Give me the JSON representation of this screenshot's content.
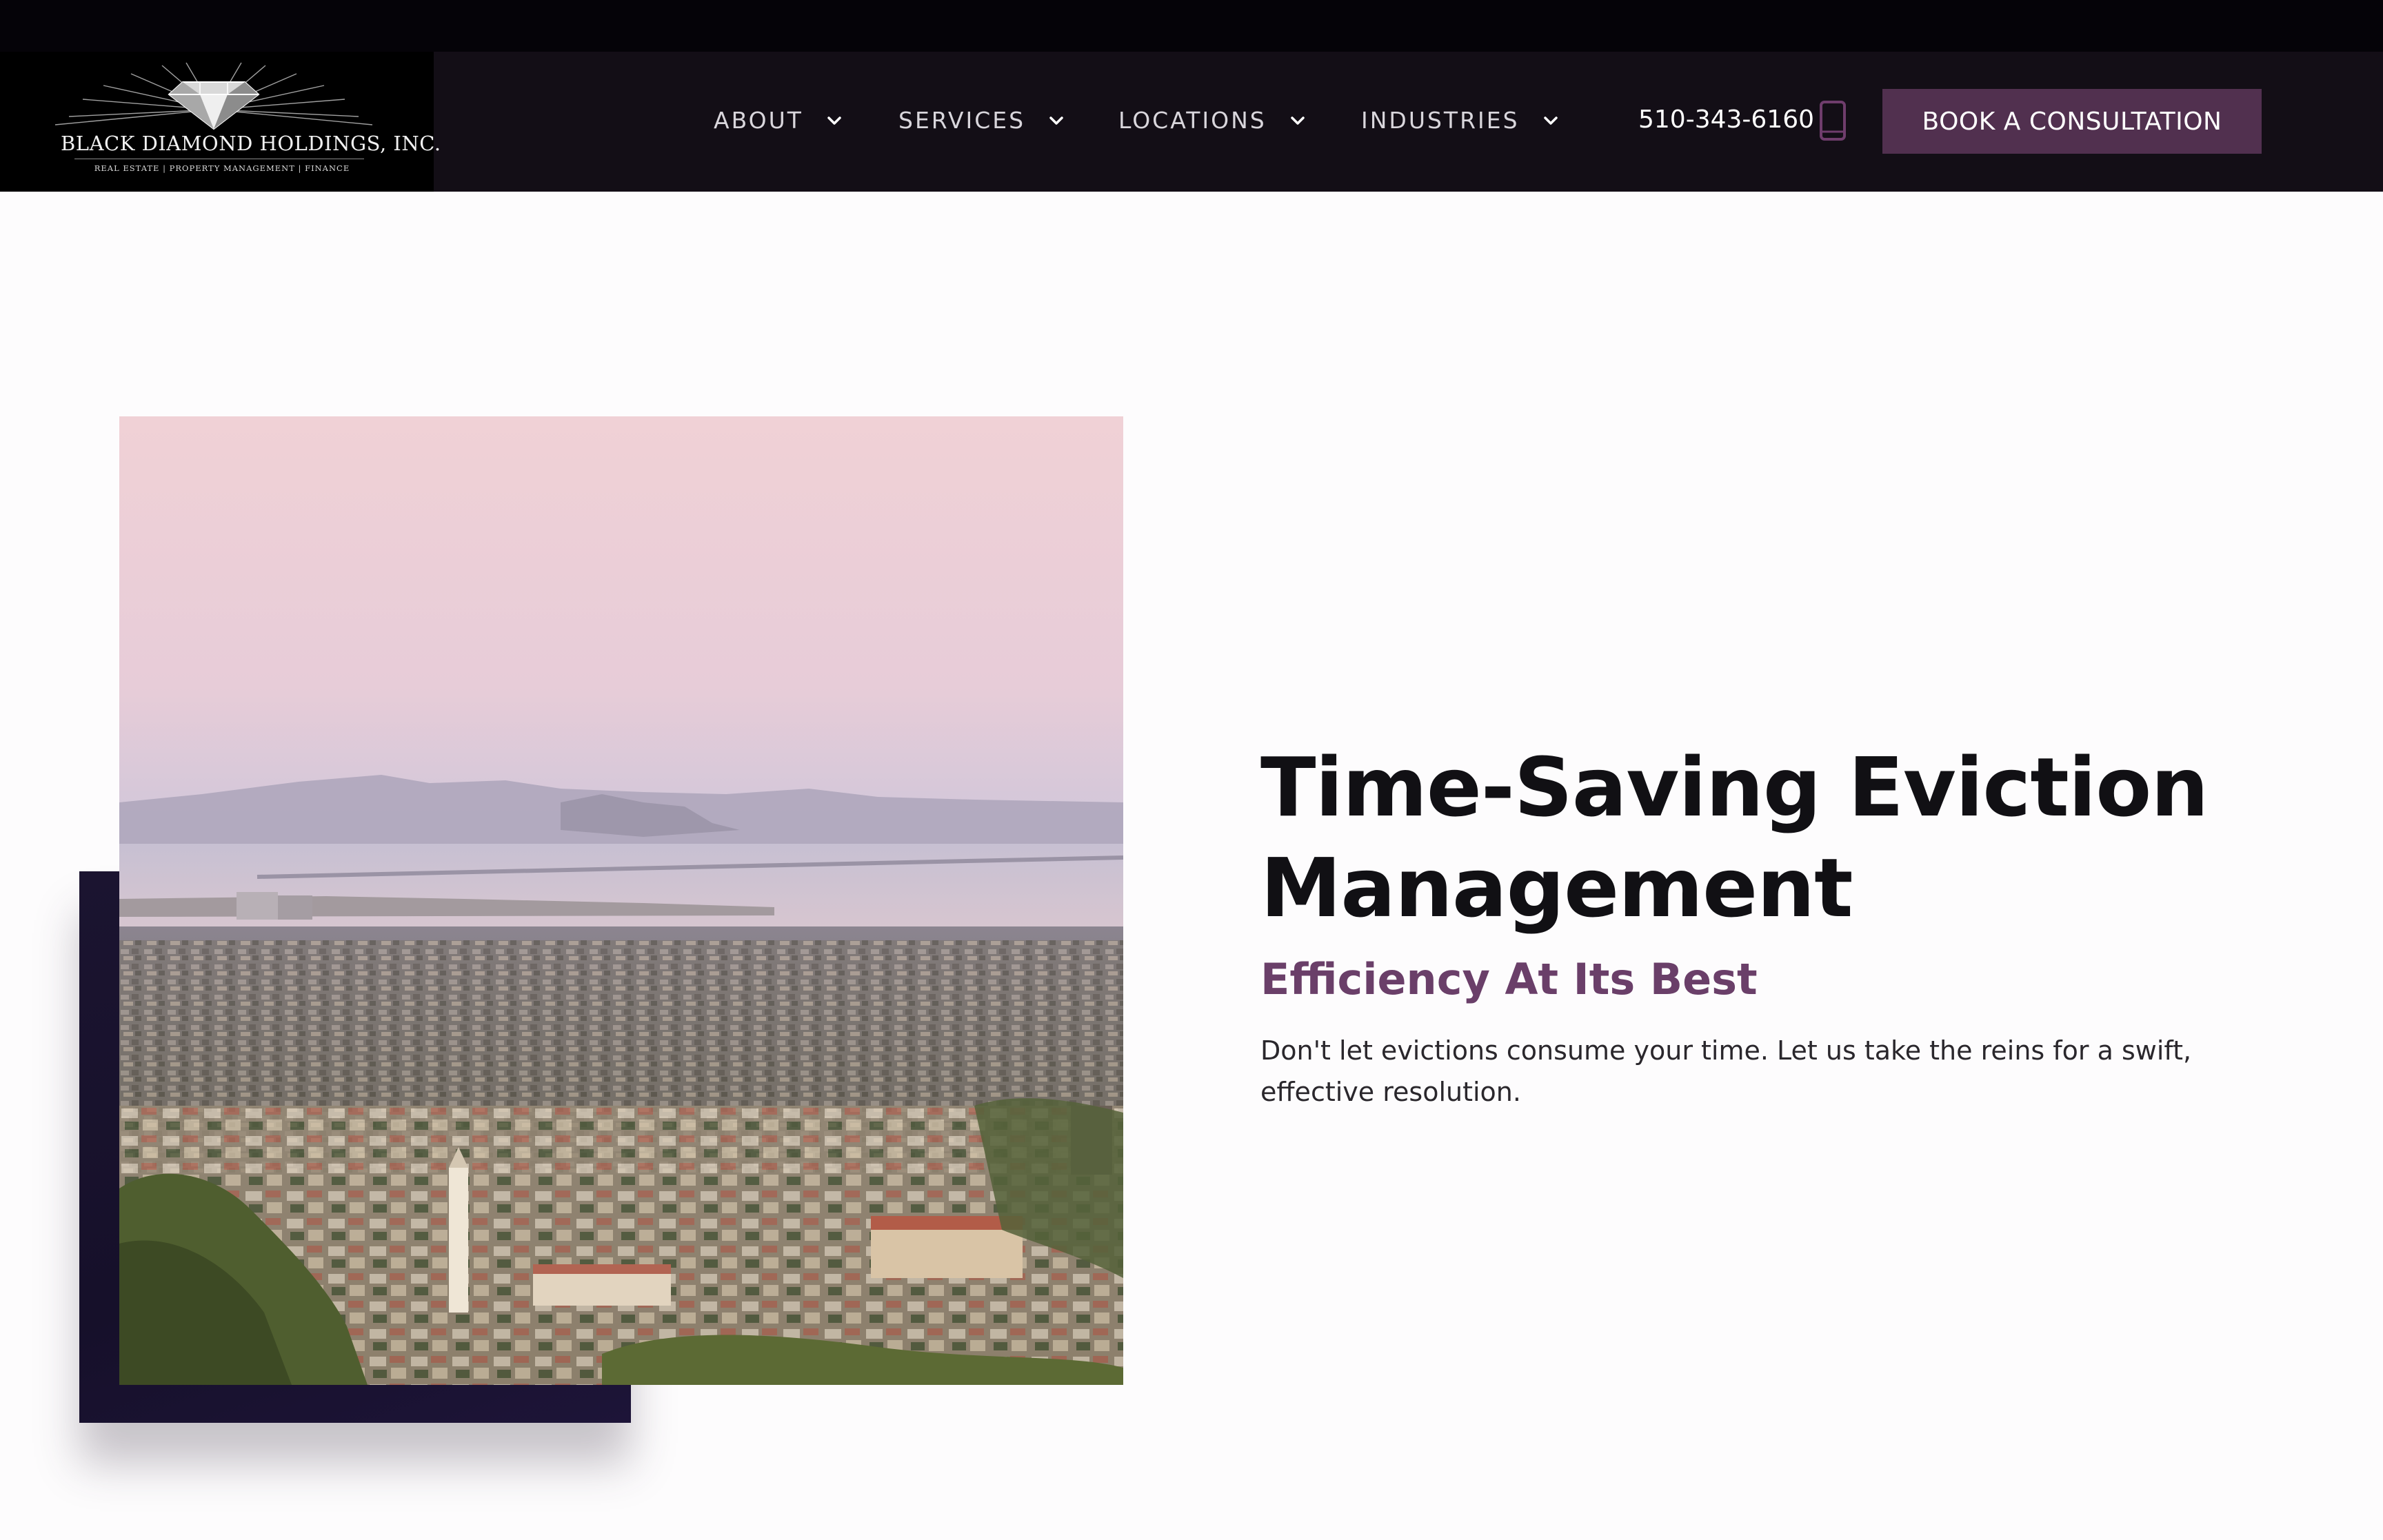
{
  "brand": {
    "name": "BLACK  DIAMOND HOLDINGS, INC.",
    "tagline": "REAL ESTATE  |  PROPERTY MANAGEMENT  |  FINANCE"
  },
  "nav": {
    "items": [
      {
        "label": "ABOUT"
      },
      {
        "label": "SERVICES"
      },
      {
        "label": "LOCATIONS"
      },
      {
        "label": "INDUSTRIES"
      }
    ]
  },
  "contact": {
    "phone": "510-343-6160"
  },
  "cta": {
    "label": "BOOK A CONSULTATION"
  },
  "hero": {
    "title": "Time-Saving Eviction Management",
    "subtitle": "Efficiency At Its Best",
    "body": "Don't let evictions consume your time. Let us take the reins for a swift, effective resolution."
  },
  "colors": {
    "header_bg": "#130e16",
    "accent": "#51304f",
    "subtitle": "#6a3f69",
    "heading": "#111014"
  },
  "icons": {
    "nav_dropdown": "chevron-down-icon",
    "phone": "phone-icon",
    "logo": "diamond-logo-icon"
  }
}
